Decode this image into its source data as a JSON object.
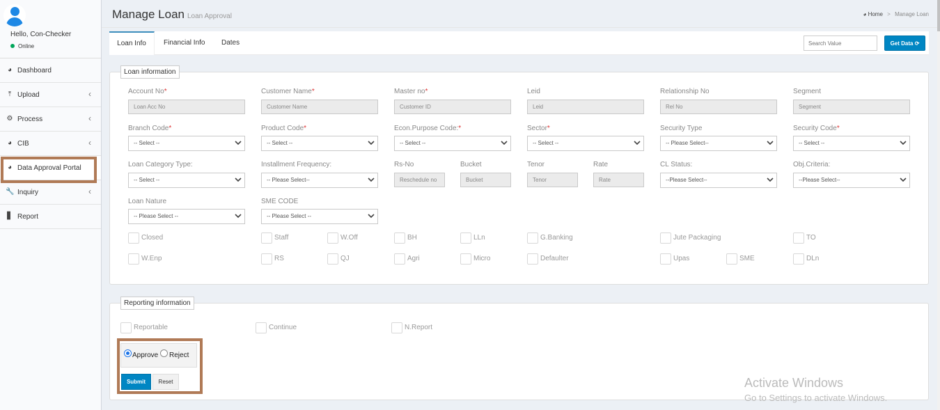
{
  "sidebar": {
    "greeting": "Hello, Con-Checker",
    "status": "Online",
    "items": [
      {
        "label": "Dashboard",
        "icon": "dashboard-icon"
      },
      {
        "label": "Upload",
        "icon": "upload-icon"
      },
      {
        "label": "Process",
        "icon": "gears-icon"
      },
      {
        "label": "CIB",
        "icon": "dashboard-icon"
      },
      {
        "label": "Data Approval Portal",
        "icon": "dashboard-icon"
      },
      {
        "label": "Inquiry",
        "icon": "wrench-icon"
      },
      {
        "label": "Report",
        "icon": "bar-chart-icon"
      }
    ]
  },
  "header": {
    "title": "Manage Loan",
    "subtitle": "Loan Approval",
    "breadcrumb_home": "Home",
    "breadcrumb_sep": ">",
    "breadcrumb_current": "Manage Loan"
  },
  "tabs": [
    {
      "label": "Loan Info"
    },
    {
      "label": "Financial Info"
    },
    {
      "label": "Dates"
    }
  ],
  "search": {
    "placeholder": "Search Value"
  },
  "get_data_label": "Get Data",
  "loan_info": {
    "legend": "Loan information",
    "fields": {
      "account_no": {
        "label": "Account No",
        "placeholder": "Loan Acc No"
      },
      "customer_name": {
        "label": "Customer Name",
        "placeholder": "Customer Name"
      },
      "master_no": {
        "label": "Master no",
        "placeholder": "Customer ID"
      },
      "leid": {
        "label": "Leid",
        "placeholder": "Leid"
      },
      "relationship_no": {
        "label": "Relationship No",
        "placeholder": "Rel No"
      },
      "segment": {
        "label": "Segment",
        "placeholder": "Segment"
      },
      "branch_code": {
        "label": "Branch Code",
        "value": "-- Select --"
      },
      "product_code": {
        "label": "Product Code",
        "value": "-- Select --"
      },
      "econ_purpose": {
        "label": "Econ.Purpose Code:",
        "value": "-- Select --"
      },
      "sector": {
        "label": "Sector",
        "value": "-- Select --"
      },
      "security_type": {
        "label": "Security Type",
        "value": "-- Please Select--"
      },
      "security_code": {
        "label": "Security Code",
        "value": "-- Select --"
      },
      "loan_category": {
        "label": "Loan Category Type:",
        "value": "-- Select --"
      },
      "installment_freq": {
        "label": "Installment Frequency:",
        "value": "-- Please Select--"
      },
      "rs_no": {
        "label": "Rs-No",
        "placeholder": "Reschedule no"
      },
      "bucket": {
        "label": "Bucket",
        "placeholder": "Bucket"
      },
      "tenor": {
        "label": "Tenor",
        "placeholder": "Tenor"
      },
      "rate": {
        "label": "Rate",
        "placeholder": "Rate"
      },
      "cl_status": {
        "label": "CL Status:",
        "value": "--Please Select--"
      },
      "obj_criteria": {
        "label": "Obj.Criteria:",
        "value": "--Please Select--"
      },
      "loan_nature": {
        "label": "Loan Nature",
        "value": "-- Please Select --"
      },
      "sme_code": {
        "label": "SME CODE",
        "value": "-- Please Select --"
      }
    },
    "checkboxes_row1": [
      "Closed",
      "Staff",
      "W.Off",
      "BH",
      "LLn",
      "G.Banking",
      "Jute Packaging",
      "TO"
    ],
    "checkboxes_row2": [
      "W.Enp",
      "RS",
      "QJ",
      "Agri",
      "Micro",
      "Defaulter",
      "Upas",
      "SME",
      "DLn"
    ]
  },
  "reporting_info": {
    "legend": "Reporting information",
    "checkboxes": [
      "Reportable",
      "Continue",
      "N.Report"
    ],
    "radio_approve": "Approve",
    "radio_reject": "Reject",
    "submit_label": "Submit",
    "reset_label": "Reset"
  },
  "watermark": {
    "line1": "Activate Windows",
    "line2": "Go to Settings to activate Windows."
  },
  "colors": {
    "accent": "#0086c3",
    "highlight": "#b07a56",
    "online": "#00a65a"
  }
}
